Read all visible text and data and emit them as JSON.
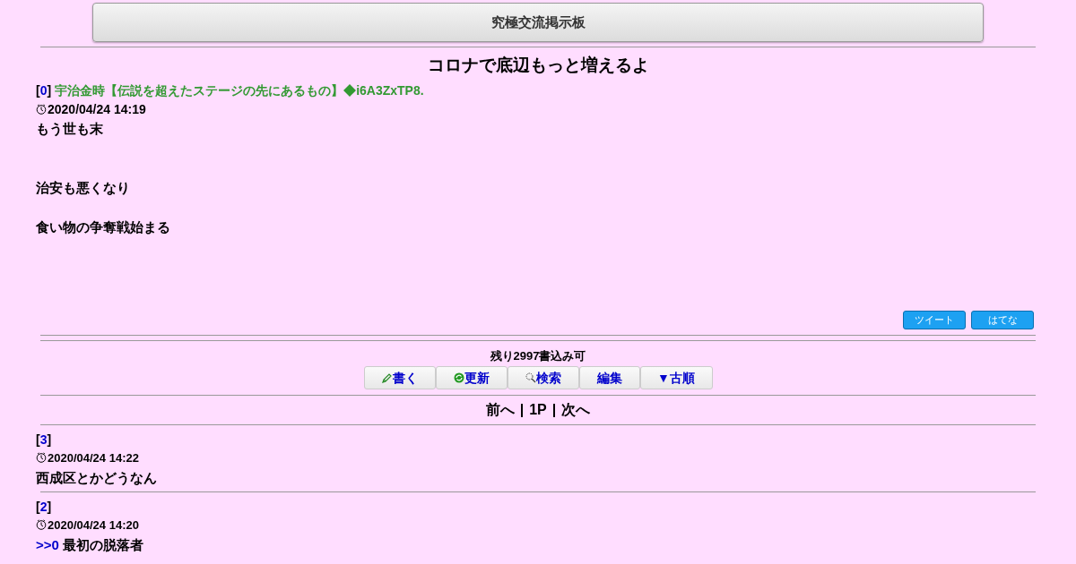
{
  "header": {
    "title": "究極交流掲示板"
  },
  "thread_title": "コロナで底辺もっと増えるよ",
  "first_post": {
    "bracket_open": "[",
    "number": "0",
    "bracket_close": "]",
    "author": "宇治金時【伝説を超えたステージの先にあるもの】◆i6A3ZxTP8.",
    "date": "2020/04/24 14:19",
    "lines": [
      "もう世も末",
      "治安も悪くなり",
      "食い物の争奪戦始まる"
    ]
  },
  "share_buttons": [
    "ツイート",
    "はてな"
  ],
  "remaining": "残り2997書込み可",
  "toolbar": [
    {
      "kind": "pencil",
      "label": "書く"
    },
    {
      "kind": "refresh",
      "label": "更新"
    },
    {
      "kind": "search",
      "label": "検索"
    },
    {
      "kind": "plain",
      "label": "編集"
    },
    {
      "kind": "plain",
      "label": "▼古順"
    }
  ],
  "pager": {
    "prev": "前へ",
    "sep1": "|",
    "page": "1P",
    "sep2": "|",
    "next": "次へ"
  },
  "posts": [
    {
      "bracket_open": "[",
      "number": "3",
      "bracket_close": "]",
      "date": "2020/04/24 14:22",
      "text": "西成区とかどうなん"
    },
    {
      "bracket_open": "[",
      "number": "2",
      "bracket_close": "]",
      "date": "2020/04/24 14:20",
      "reply": ">>0",
      "text": "最初の脱落者"
    }
  ]
}
